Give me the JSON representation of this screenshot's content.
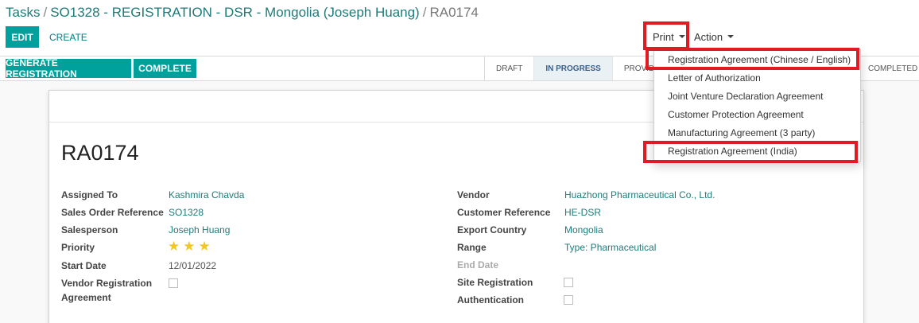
{
  "breadcrumb": {
    "item1": "Tasks",
    "item2": "SO1328 - REGISTRATION - DSR - Mongolia (Joseph Huang)",
    "current": "RA0174",
    "separator": "/"
  },
  "toolbar": {
    "edit_label": "EDIT",
    "create_label": "CREATE",
    "print_label": "Print",
    "action_label": "Action"
  },
  "statusbar": {
    "generate_label": "GENERATE REGISTRATION",
    "complete_label": "COMPLETE",
    "stages": [
      "DRAFT",
      "IN PROGRESS",
      "PROVIDE",
      "COMPLETED"
    ],
    "active_stage": "IN PROGRESS"
  },
  "print_menu": {
    "items": [
      "Registration Agreement (Chinese / English)",
      "Letter of Authorization",
      "Joint Venture Declaration Agreement",
      "Customer Protection Agreement",
      "Manufacturing Agreement (3 party)",
      "Registration Agreement (India)"
    ]
  },
  "highlight_color": "#e01b24",
  "record": {
    "title": "RA0174",
    "left": {
      "assigned_to": {
        "label": "Assigned To",
        "value": "Kashmira Chavda"
      },
      "sales_order": {
        "label": "Sales Order Reference",
        "value": "SO1328"
      },
      "salesperson": {
        "label": "Salesperson",
        "value": "Joseph Huang"
      },
      "priority": {
        "label": "Priority",
        "stars": 3,
        "max_stars": 3
      },
      "start_date": {
        "label": "Start Date",
        "value": "12/01/2022"
      },
      "vendor_reg": {
        "label_line1": "Vendor Registration",
        "label_line2": "Agreement",
        "checked": false
      }
    },
    "right": {
      "vendor": {
        "label": "Vendor",
        "value": "Huazhong Pharmaceutical Co., Ltd."
      },
      "customer_ref": {
        "label": "Customer Reference",
        "value": "HE-DSR"
      },
      "export_country": {
        "label": "Export Country",
        "value": "Mongolia"
      },
      "range": {
        "label": "Range",
        "value": "Type: Pharmaceutical"
      },
      "end_date": {
        "label": "End Date",
        "value": ""
      },
      "site_registration": {
        "label": "Site Registration",
        "checked": false
      },
      "authentication": {
        "label": "Authentication",
        "checked": false
      }
    }
  },
  "colors": {
    "primary": "#00a09d",
    "link": "#1f7a7a",
    "star": "#f3c623"
  }
}
